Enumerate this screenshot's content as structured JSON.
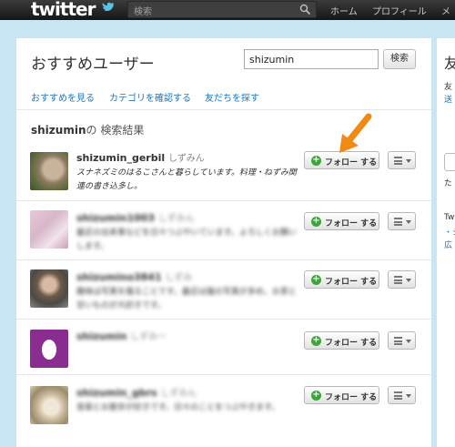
{
  "topbar": {
    "logo": "twitter",
    "search_placeholder": "検索",
    "nav": [
      "ホーム",
      "プロフィール",
      "メ"
    ]
  },
  "panel": {
    "title": "おすすめユーザー",
    "search_value": "shizumin",
    "search_button": "検索",
    "links": [
      "おすすめを見る",
      "カテゴリを確認する",
      "友だちを探す"
    ],
    "results_query": "shizumin",
    "results_suffix": "の 検索結果"
  },
  "follow_label": "フォロー する",
  "users": [
    {
      "username": "shizumin_gerbil",
      "display": "しずみん",
      "bio": "スナネズミのはるこさんと暮らしています。料理・ねずみ関連の書き込多し。",
      "blurred": false
    },
    {
      "username": "shizumin1003",
      "display": "しずみん",
      "bio": "最近の出来事などを日々つぶやいています。よろしくお願いします。",
      "blurred": true
    },
    {
      "username": "shizumino3841",
      "display": "しずみ",
      "bio": "趣味は写真を撮ることです。最近は猫の写真が多め。お茶と甘いものが大好きです。",
      "blurred": true
    },
    {
      "username": "shizumin",
      "display": "しずみー",
      "bio": "",
      "blurred": true
    },
    {
      "username": "shizumin_gbrs",
      "display": "しずみん",
      "bio": "音楽とお散歩が好きです。日々のことをつぶやきます。",
      "blurred": true
    }
  ],
  "sidebar": {
    "title": "友",
    "text1": "友",
    "link1": "送",
    "text2": "た",
    "text3": "Tw",
    "link2": "・シ",
    "link3": "広"
  },
  "colors": {
    "background": "#c8e6f4",
    "link": "#2276bb",
    "follow_icon": "#3fa33f",
    "arrow": "#f08a14"
  },
  "icons": [
    "search-icon",
    "bird-icon",
    "plus-icon",
    "list-icon",
    "chevron-down-icon",
    "arrow-pointer-icon"
  ]
}
